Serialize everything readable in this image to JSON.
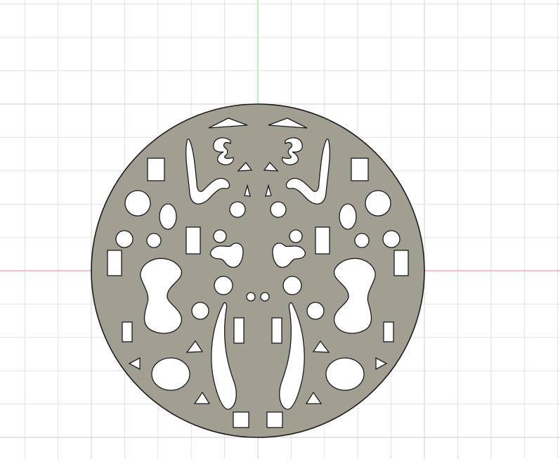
{
  "viewport": {
    "background": "#ffffff",
    "grid_minor_color": "#e2e2e2",
    "grid_major_color": "#cfcfcf",
    "x_axis_color": "#f08080",
    "y_axis_color": "#7fe07f"
  },
  "part": {
    "fill_color": "#a39e92",
    "outline_color": "#1a1a1a",
    "shape": "circular plate with mirrored cutouts"
  }
}
